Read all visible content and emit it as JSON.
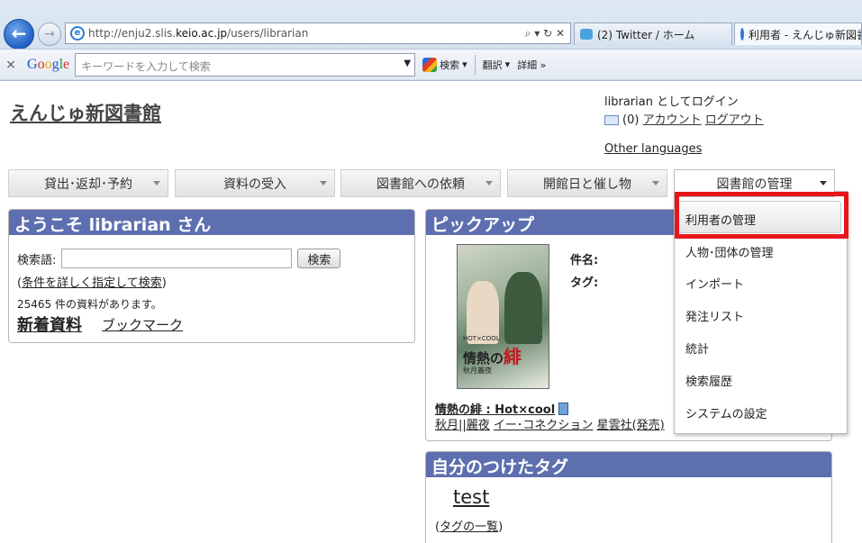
{
  "browser": {
    "url_prefix": "http://enju2.slis.",
    "url_domain": "keio.ac.jp",
    "url_path": "/users/librarian",
    "addr_tools": "⌕ ▾ ↻ ✕",
    "tabs": [
      {
        "label": "(2) Twitter / ホーム"
      },
      {
        "label": "利用者 - えんじゅ新図書"
      }
    ],
    "google_toolbar": {
      "close": "×",
      "search_placeholder": "キーワードを入力して検索",
      "search_btn": "検索",
      "translate_btn": "翻訳",
      "more_btn": "詳細 »"
    }
  },
  "page": {
    "site_title": "えんじゅ新図書館",
    "login_text": "librarian としてログイン",
    "mail_count": "(0)",
    "account_link": "アカウント",
    "logout_link": "ログアウト",
    "other_languages": "Other languages"
  },
  "menu": [
    {
      "label": "貸出･返却･予約"
    },
    {
      "label": "資料の受入"
    },
    {
      "label": "図書館への依頼"
    },
    {
      "label": "開館日と催し物"
    },
    {
      "label": "図書館の管理"
    }
  ],
  "dropdown_items": [
    {
      "label": "利用者の管理"
    },
    {
      "label": "人物･団体の管理"
    },
    {
      "label": "インポート"
    },
    {
      "label": "発注リスト"
    },
    {
      "label": "統計"
    },
    {
      "label": "検索履歴"
    },
    {
      "label": "システムの設定"
    }
  ],
  "welcome": {
    "heading": "ようこそ librarian さん",
    "search_label": "検索語:",
    "search_button": "検索",
    "advanced_open": "(",
    "advanced_link": "条件を詳しく指定して検索",
    "advanced_close": ")",
    "count_text": "25465 件の資料があります。",
    "new_books": "新着資料",
    "bookmark": "ブックマーク"
  },
  "pickup": {
    "heading": "ピックアップ",
    "subject_label": "件名:",
    "tag_label": "タグ:",
    "cover_title_a": "情熱の",
    "cover_title_b": "緋",
    "cover_series": "HOT×COOL",
    "cover_author": "秋月麗夜",
    "book_title": "情熱の緋 : Hot×cool",
    "author": "秋月||麗夜",
    "illustrator": "イー･コネクション",
    "publisher": "星雲社(発売)"
  },
  "my_tags": {
    "heading": "自分のつけたタグ",
    "tag": "test",
    "list_open": "(",
    "list_link": "タグの一覧",
    "list_close": ")"
  },
  "colors": {
    "panel_header": "#5e6fb0",
    "highlight_box": "#e8161b"
  }
}
